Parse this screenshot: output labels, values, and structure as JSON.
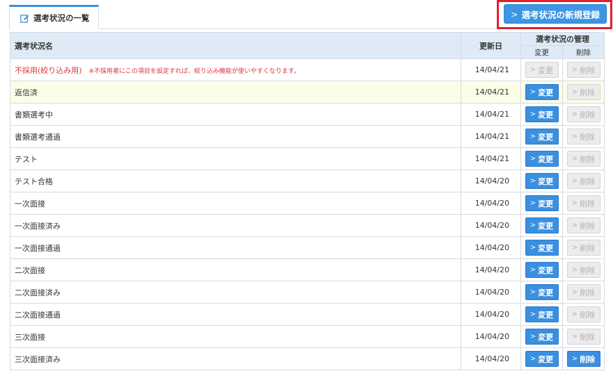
{
  "tab": {
    "label": "選考状況の一覧",
    "icon": "edit-icon"
  },
  "new_button": {
    "label": "選考状況の新規登録"
  },
  "table": {
    "headers": {
      "name": "選考状況名",
      "updated": "更新日",
      "manage": "選考状況の管理",
      "edit": "変更",
      "delete": "削除"
    },
    "rows": [
      {
        "name": "不採用(絞り込み用)",
        "note": "※不採用者にこの項目を設定すれば、絞り込み機能が使いやすくなります。",
        "date": "14/04/21",
        "edit": "変更",
        "delete": "削除",
        "edit_enabled": false,
        "delete_enabled": false,
        "highlight": false,
        "name_color": "#e0353a"
      },
      {
        "name": "返信済",
        "note": "",
        "date": "14/04/21",
        "edit": "変更",
        "delete": "削除",
        "edit_enabled": true,
        "delete_enabled": false,
        "highlight": true
      },
      {
        "name": "書類選考中",
        "note": "",
        "date": "14/04/21",
        "edit": "変更",
        "delete": "削除",
        "edit_enabled": true,
        "delete_enabled": false,
        "highlight": false
      },
      {
        "name": "書類選考通過",
        "note": "",
        "date": "14/04/21",
        "edit": "変更",
        "delete": "削除",
        "edit_enabled": true,
        "delete_enabled": false,
        "highlight": false
      },
      {
        "name": "テスト",
        "note": "",
        "date": "14/04/21",
        "edit": "変更",
        "delete": "削除",
        "edit_enabled": true,
        "delete_enabled": false,
        "highlight": false
      },
      {
        "name": "テスト合格",
        "note": "",
        "date": "14/04/20",
        "edit": "変更",
        "delete": "削除",
        "edit_enabled": true,
        "delete_enabled": false,
        "highlight": false
      },
      {
        "name": "一次面接",
        "note": "",
        "date": "14/04/20",
        "edit": "変更",
        "delete": "削除",
        "edit_enabled": true,
        "delete_enabled": false,
        "highlight": false
      },
      {
        "name": "一次面接済み",
        "note": "",
        "date": "14/04/20",
        "edit": "変更",
        "delete": "削除",
        "edit_enabled": true,
        "delete_enabled": false,
        "highlight": false
      },
      {
        "name": "一次面接通過",
        "note": "",
        "date": "14/04/20",
        "edit": "変更",
        "delete": "削除",
        "edit_enabled": true,
        "delete_enabled": false,
        "highlight": false
      },
      {
        "name": "二次面接",
        "note": "",
        "date": "14/04/20",
        "edit": "変更",
        "delete": "削除",
        "edit_enabled": true,
        "delete_enabled": false,
        "highlight": false
      },
      {
        "name": "二次面接済み",
        "note": "",
        "date": "14/04/20",
        "edit": "変更",
        "delete": "削除",
        "edit_enabled": true,
        "delete_enabled": false,
        "highlight": false
      },
      {
        "name": "二次面接通過",
        "note": "",
        "date": "14/04/20",
        "edit": "変更",
        "delete": "削除",
        "edit_enabled": true,
        "delete_enabled": false,
        "highlight": false
      },
      {
        "name": "三次面接",
        "note": "",
        "date": "14/04/20",
        "edit": "変更",
        "delete": "削除",
        "edit_enabled": true,
        "delete_enabled": false,
        "highlight": false
      },
      {
        "name": "三次面接済み",
        "note": "",
        "date": "14/04/20",
        "edit": "変更",
        "delete": "削除",
        "edit_enabled": true,
        "delete_enabled": true,
        "highlight": false
      }
    ]
  },
  "colors": {
    "accent": "#3a8fe0",
    "header_bg": "#deebf7",
    "highlight_row": "#fcfde7",
    "disabled_button": "#ececec",
    "alert_red": "#e0353a",
    "callout_border": "#e0202a"
  }
}
